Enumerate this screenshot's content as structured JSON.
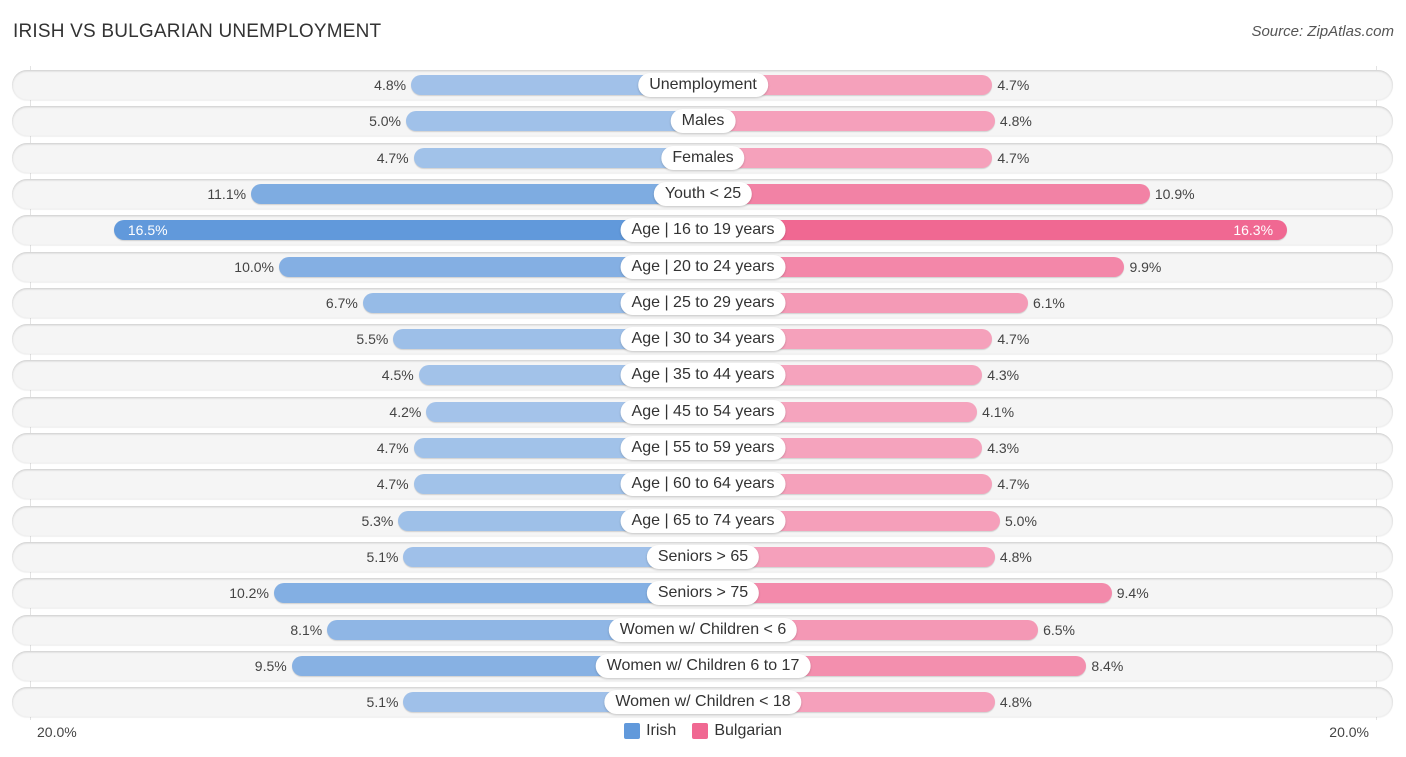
{
  "header": {
    "title": "IRISH VS BULGARIAN UNEMPLOYMENT",
    "source": "Source: ZipAtlas.com"
  },
  "colors": {
    "irish": "#a5c4ea",
    "irish_strong": "#6199db",
    "bulgarian": "#f5a4be",
    "bulgarian_strong": "#f06892"
  },
  "chart_data": {
    "type": "bar",
    "orientation": "horizontal-diverging",
    "title": "IRISH VS BULGARIAN UNEMPLOYMENT",
    "xlabel": "",
    "ylabel": "",
    "xlim": [
      -20.0,
      20.0
    ],
    "axis_labels": {
      "left": "20.0%",
      "right": "20.0%"
    },
    "legend": {
      "position": "bottom-center",
      "entries": [
        "Irish",
        "Bulgarian"
      ]
    },
    "categories": [
      "Unemployment",
      "Males",
      "Females",
      "Youth < 25",
      "Age | 16 to 19 years",
      "Age | 20 to 24 years",
      "Age | 25 to 29 years",
      "Age | 30 to 34 years",
      "Age | 35 to 44 years",
      "Age | 45 to 54 years",
      "Age | 55 to 59 years",
      "Age | 60 to 64 years",
      "Age | 65 to 74 years",
      "Seniors > 65",
      "Seniors > 75",
      "Women w/ Children < 6",
      "Women w/ Children 6 to 17",
      "Women w/ Children < 18"
    ],
    "series": [
      {
        "name": "Irish",
        "side": "left",
        "values": [
          4.8,
          5.0,
          4.7,
          11.1,
          16.5,
          10.0,
          6.7,
          5.5,
          4.5,
          4.2,
          4.7,
          4.7,
          5.3,
          5.1,
          10.2,
          8.1,
          9.5,
          5.1
        ],
        "labels": [
          "4.8%",
          "5.0%",
          "4.7%",
          "11.1%",
          "16.5%",
          "10.0%",
          "6.7%",
          "5.5%",
          "4.5%",
          "4.2%",
          "4.7%",
          "4.7%",
          "5.3%",
          "5.1%",
          "10.2%",
          "8.1%",
          "9.5%",
          "5.1%"
        ]
      },
      {
        "name": "Bulgarian",
        "side": "right",
        "values": [
          4.7,
          4.8,
          4.7,
          10.9,
          16.3,
          9.9,
          6.1,
          4.7,
          4.3,
          4.1,
          4.3,
          4.7,
          5.0,
          4.8,
          9.4,
          6.5,
          8.4,
          4.8
        ],
        "labels": [
          "4.7%",
          "4.8%",
          "4.7%",
          "10.9%",
          "16.3%",
          "9.9%",
          "6.1%",
          "4.7%",
          "4.3%",
          "4.1%",
          "4.3%",
          "4.7%",
          "5.0%",
          "4.8%",
          "9.4%",
          "6.5%",
          "8.4%",
          "4.8%"
        ]
      }
    ],
    "highlighted_row": "Age | 16 to 19 years"
  }
}
